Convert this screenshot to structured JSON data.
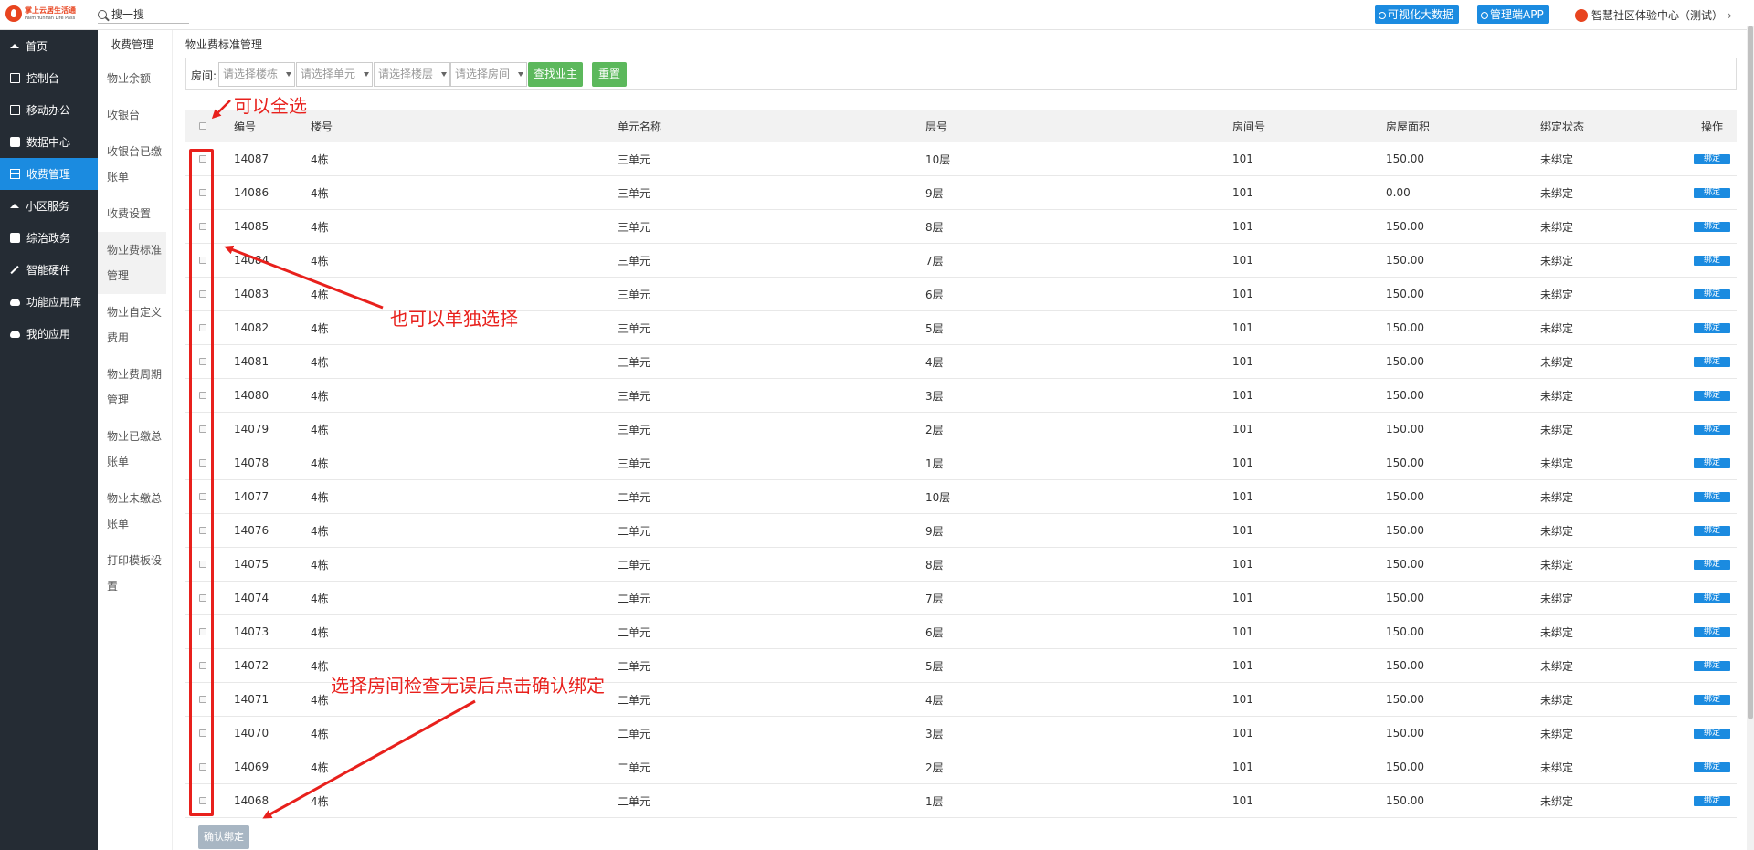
{
  "topbar": {
    "logo_cn": "掌上云居生活通",
    "logo_en": "Palm Yunnan Life Pass",
    "search_text": "搜一搜",
    "bigdata_label": "可视化大数据",
    "app_label": "管理端APP",
    "org_label": "智慧社区体验中心（测试）",
    "org_chevron": "›"
  },
  "sidebar": {
    "items": [
      {
        "label": "首页",
        "icon": "home-icon"
      },
      {
        "label": "控制台",
        "icon": "laptop-icon"
      },
      {
        "label": "移动办公",
        "icon": "mobile-icon"
      },
      {
        "label": "数据中心",
        "icon": "briefcase-icon"
      },
      {
        "label": "收费管理",
        "icon": "credit-card-icon",
        "active": true
      },
      {
        "label": "小区服务",
        "icon": "home-icon"
      },
      {
        "label": "综治政务",
        "icon": "bank-icon"
      },
      {
        "label": "智能硬件",
        "icon": "wrench-icon"
      },
      {
        "label": "功能应用库",
        "icon": "cloud-upload-icon"
      },
      {
        "label": "我的应用",
        "icon": "cloud-icon"
      }
    ]
  },
  "submenu": {
    "title": "收费管理",
    "items": [
      "物业余额",
      "收银台",
      "收银台已缴账单",
      "收费设置",
      "物业费标准管理",
      "物业自定义费用",
      "物业费周期管理",
      "物业已缴总账单",
      "物业未缴总账单",
      "打印模板设置"
    ]
  },
  "breadcrumb": "物业费标准管理",
  "filter": {
    "label": "房间:",
    "building_placeholder": "请选择楼栋",
    "unit_placeholder": "请选择单元",
    "floor_placeholder": "请选择楼层",
    "room_placeholder": "请选择房间",
    "find_label": "查找业主",
    "reset_label": "重置"
  },
  "table": {
    "headers": {
      "no": "编号",
      "building": "楼号",
      "unit": "单元名称",
      "floor": "层号",
      "room": "房间号",
      "area": "房屋面积",
      "state": "绑定状态",
      "op": "操作"
    },
    "bind_label": "绑定",
    "rows": [
      [
        "14087",
        "4栋",
        "三单元",
        "10层",
        "101",
        "150.00",
        "未绑定"
      ],
      [
        "14086",
        "4栋",
        "三单元",
        "9层",
        "101",
        "0.00",
        "未绑定"
      ],
      [
        "14085",
        "4栋",
        "三单元",
        "8层",
        "101",
        "150.00",
        "未绑定"
      ],
      [
        "14084",
        "4栋",
        "三单元",
        "7层",
        "101",
        "150.00",
        "未绑定"
      ],
      [
        "14083",
        "4栋",
        "三单元",
        "6层",
        "101",
        "150.00",
        "未绑定"
      ],
      [
        "14082",
        "4栋",
        "三单元",
        "5层",
        "101",
        "150.00",
        "未绑定"
      ],
      [
        "14081",
        "4栋",
        "三单元",
        "4层",
        "101",
        "150.00",
        "未绑定"
      ],
      [
        "14080",
        "4栋",
        "三单元",
        "3层",
        "101",
        "150.00",
        "未绑定"
      ],
      [
        "14079",
        "4栋",
        "三单元",
        "2层",
        "101",
        "150.00",
        "未绑定"
      ],
      [
        "14078",
        "4栋",
        "三单元",
        "1层",
        "101",
        "150.00",
        "未绑定"
      ],
      [
        "14077",
        "4栋",
        "二单元",
        "10层",
        "101",
        "150.00",
        "未绑定"
      ],
      [
        "14076",
        "4栋",
        "二单元",
        "9层",
        "101",
        "150.00",
        "未绑定"
      ],
      [
        "14075",
        "4栋",
        "二单元",
        "8层",
        "101",
        "150.00",
        "未绑定"
      ],
      [
        "14074",
        "4栋",
        "二单元",
        "7层",
        "101",
        "150.00",
        "未绑定"
      ],
      [
        "14073",
        "4栋",
        "二单元",
        "6层",
        "101",
        "150.00",
        "未绑定"
      ],
      [
        "14072",
        "4栋",
        "二单元",
        "5层",
        "101",
        "150.00",
        "未绑定"
      ],
      [
        "14071",
        "4栋",
        "二单元",
        "4层",
        "101",
        "150.00",
        "未绑定"
      ],
      [
        "14070",
        "4栋",
        "二单元",
        "3层",
        "101",
        "150.00",
        "未绑定"
      ],
      [
        "14069",
        "4栋",
        "二单元",
        "2层",
        "101",
        "150.00",
        "未绑定"
      ],
      [
        "14068",
        "4栋",
        "二单元",
        "1层",
        "101",
        "150.00",
        "未绑定"
      ]
    ]
  },
  "confirm_label": "确认绑定",
  "annotations": {
    "select_all": "可以全选",
    "select_single": "也可以单独选择",
    "confirm_hint": "选择房间检查无误后点击确认绑定",
    "color": "#e8201c"
  }
}
